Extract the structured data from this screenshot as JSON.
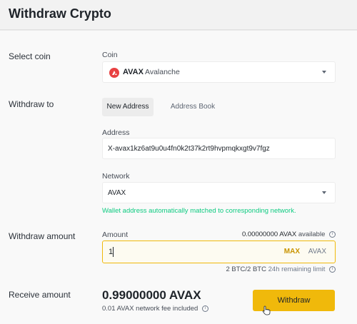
{
  "header": {
    "title": "Withdraw Crypto"
  },
  "select_coin": {
    "row_label": "Select coin",
    "field_label": "Coin",
    "symbol": "AVAX",
    "name": "Avalanche",
    "logo_color": "#e84142",
    "logo_icon": "avalanche-logo"
  },
  "withdraw_to": {
    "row_label": "Withdraw to",
    "tabs": [
      {
        "label": "New Address",
        "active": true
      },
      {
        "label": "Address Book",
        "active": false
      }
    ],
    "address_label": "Address",
    "address_value": "X-avax1kz6at9u0u4fn0k2t37k2rt9hvpmqkxgt9v7fgz",
    "network_label": "Network",
    "network_value": "AVAX",
    "network_message": "Wallet address automatically matched to corresponding network."
  },
  "withdraw_amount": {
    "row_label": "Withdraw amount",
    "field_label": "Amount",
    "available_amount": "0.00000000 AVAX",
    "available_text": "available",
    "input_value": "1",
    "max_label": "MAX",
    "unit": "AVAX",
    "limit_amount": "2 BTC/2 BTC",
    "limit_text": "24h remaining limit"
  },
  "receive": {
    "row_label": "Receive amount",
    "value": "0.99000000 AVAX",
    "fee_text": "0.01 AVAX network fee included",
    "button_label": "Withdraw"
  },
  "colors": {
    "accent": "#f0b90b",
    "success": "#0ecb81",
    "max_text": "#c99400"
  }
}
